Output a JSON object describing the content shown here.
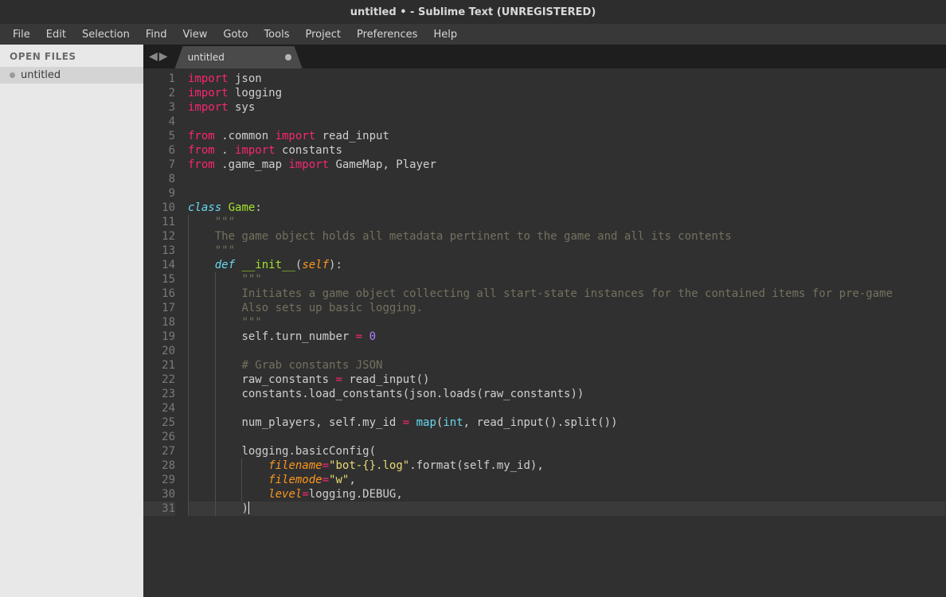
{
  "window": {
    "title": "untitled • - Sublime Text (UNREGISTERED)"
  },
  "menu": [
    "File",
    "Edit",
    "Selection",
    "Find",
    "View",
    "Goto",
    "Tools",
    "Project",
    "Preferences",
    "Help"
  ],
  "sidebar": {
    "header": "OPEN FILES",
    "files": [
      {
        "name": "untitled",
        "modified": true
      }
    ]
  },
  "tabs": [
    {
      "label": "untitled",
      "modified": true,
      "active": true
    }
  ],
  "editor": {
    "highlighted_line": 31,
    "lines": [
      {
        "n": 1,
        "t": [
          [
            "kw",
            "import"
          ],
          [
            "",
            " json"
          ]
        ]
      },
      {
        "n": 2,
        "t": [
          [
            "kw",
            "import"
          ],
          [
            "",
            " logging"
          ]
        ]
      },
      {
        "n": 3,
        "t": [
          [
            "kw",
            "import"
          ],
          [
            "",
            " sys"
          ]
        ]
      },
      {
        "n": 4,
        "t": [
          [
            "",
            ""
          ]
        ]
      },
      {
        "n": 5,
        "t": [
          [
            "kw",
            "from"
          ],
          [
            "",
            " .common "
          ],
          [
            "kw",
            "import"
          ],
          [
            "",
            " read_input"
          ]
        ]
      },
      {
        "n": 6,
        "t": [
          [
            "kw",
            "from"
          ],
          [
            "",
            " . "
          ],
          [
            "kw",
            "import"
          ],
          [
            "",
            " constants"
          ]
        ]
      },
      {
        "n": 7,
        "t": [
          [
            "kw",
            "from"
          ],
          [
            "",
            " .game_map "
          ],
          [
            "kw",
            "import"
          ],
          [
            "",
            " GameMap, Player"
          ]
        ]
      },
      {
        "n": 8,
        "t": [
          [
            "",
            ""
          ]
        ]
      },
      {
        "n": 9,
        "t": [
          [
            "",
            ""
          ]
        ]
      },
      {
        "n": 10,
        "t": [
          [
            "kw2",
            "class"
          ],
          [
            "",
            " "
          ],
          [
            "cls",
            "Game"
          ],
          [
            "",
            ":"
          ]
        ]
      },
      {
        "n": 11,
        "g": 1,
        "t": [
          [
            "guide",
            "    "
          ],
          [
            "docq",
            "\"\"\""
          ]
        ]
      },
      {
        "n": 12,
        "g": 1,
        "t": [
          [
            "guide",
            "    "
          ],
          [
            "cm",
            "The game object holds all metadata pertinent to the game and all its contents"
          ]
        ]
      },
      {
        "n": 13,
        "g": 1,
        "t": [
          [
            "guide",
            "    "
          ],
          [
            "docq",
            "\"\"\""
          ]
        ]
      },
      {
        "n": 14,
        "g": 1,
        "t": [
          [
            "guide",
            "    "
          ],
          [
            "kw2",
            "def"
          ],
          [
            "",
            " "
          ],
          [
            "fn",
            "__init__"
          ],
          [
            "",
            "("
          ],
          [
            "param",
            "self"
          ],
          [
            "",
            "):"
          ]
        ]
      },
      {
        "n": 15,
        "g": 2,
        "t": [
          [
            "guide",
            "        "
          ],
          [
            "docq",
            "\"\"\""
          ]
        ]
      },
      {
        "n": 16,
        "g": 2,
        "t": [
          [
            "guide",
            "        "
          ],
          [
            "cm",
            "Initiates a game object collecting all start-state instances for the contained items for pre-game"
          ]
        ]
      },
      {
        "n": 17,
        "g": 2,
        "t": [
          [
            "guide",
            "        "
          ],
          [
            "cm",
            "Also sets up basic logging."
          ]
        ]
      },
      {
        "n": 18,
        "g": 2,
        "t": [
          [
            "guide",
            "        "
          ],
          [
            "docq",
            "\"\"\""
          ]
        ]
      },
      {
        "n": 19,
        "g": 2,
        "t": [
          [
            "guide",
            "        "
          ],
          [
            "",
            "self.turn_number "
          ],
          [
            "op",
            "="
          ],
          [
            "",
            " "
          ],
          [
            "num",
            "0"
          ]
        ]
      },
      {
        "n": 20,
        "g": 2,
        "t": [
          [
            "guide",
            "        "
          ]
        ]
      },
      {
        "n": 21,
        "g": 2,
        "t": [
          [
            "guide",
            "        "
          ],
          [
            "cm",
            "# Grab constants JSON"
          ]
        ]
      },
      {
        "n": 22,
        "g": 2,
        "t": [
          [
            "guide",
            "        "
          ],
          [
            "",
            "raw_constants "
          ],
          [
            "op",
            "="
          ],
          [
            "",
            " read_input()"
          ]
        ]
      },
      {
        "n": 23,
        "g": 2,
        "t": [
          [
            "guide",
            "        "
          ],
          [
            "",
            "constants.load_constants(json.loads(raw_constants))"
          ]
        ]
      },
      {
        "n": 24,
        "g": 2,
        "t": [
          [
            "guide",
            "        "
          ]
        ]
      },
      {
        "n": 25,
        "g": 2,
        "t": [
          [
            "guide",
            "        "
          ],
          [
            "",
            "num_players, self.my_id "
          ],
          [
            "op",
            "="
          ],
          [
            "",
            " "
          ],
          [
            "builtin",
            "map"
          ],
          [
            "",
            "("
          ],
          [
            "builtin",
            "int"
          ],
          [
            "",
            ", read_input().split())"
          ]
        ]
      },
      {
        "n": 26,
        "g": 2,
        "t": [
          [
            "guide",
            "        "
          ]
        ]
      },
      {
        "n": 27,
        "g": 2,
        "t": [
          [
            "guide",
            "        "
          ],
          [
            "",
            "logging.basicConfig("
          ]
        ]
      },
      {
        "n": 28,
        "g": 3,
        "t": [
          [
            "guide",
            "            "
          ],
          [
            "param",
            "filename"
          ],
          [
            "op",
            "="
          ],
          [
            "str",
            "\"bot-{}.log\""
          ],
          [
            "",
            ".format(self.my_id),"
          ]
        ]
      },
      {
        "n": 29,
        "g": 3,
        "t": [
          [
            "guide",
            "            "
          ],
          [
            "param",
            "filemode"
          ],
          [
            "op",
            "="
          ],
          [
            "str",
            "\"w\""
          ],
          [
            "",
            ","
          ]
        ]
      },
      {
        "n": 30,
        "g": 3,
        "t": [
          [
            "guide",
            "            "
          ],
          [
            "param",
            "level"
          ],
          [
            "op",
            "="
          ],
          [
            "",
            "logging.DEBUG,"
          ]
        ]
      },
      {
        "n": 31,
        "g": 2,
        "t": [
          [
            "guide",
            "        "
          ],
          [
            "",
            ")"
          ]
        ],
        "cursor": true
      }
    ]
  }
}
